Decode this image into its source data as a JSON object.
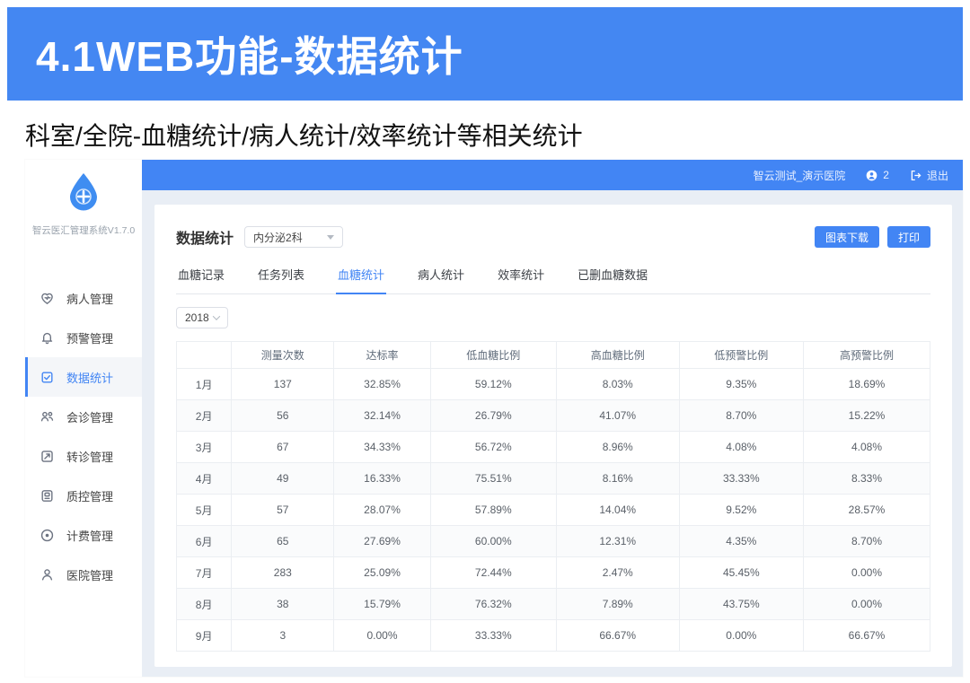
{
  "banner": {
    "title": "4.1WEB功能-数据统计"
  },
  "subtitle": "科室/全院-血糖统计/病人统计/效率统计等相关统计",
  "sidebar": {
    "system_name": "智云医汇管理系统V1.7.0",
    "logo_icon": "water-drop-medical-cross-logo",
    "items": [
      {
        "name": "patient-management",
        "label": "病人管理",
        "icon": "heart-pulse-icon",
        "active": false
      },
      {
        "name": "alert-management",
        "label": "预警管理",
        "icon": "bell-icon",
        "active": false
      },
      {
        "name": "data-statistics",
        "label": "数据统计",
        "icon": "clipboard-check-icon",
        "active": true
      },
      {
        "name": "consult-management",
        "label": "会诊管理",
        "icon": "people-icon",
        "active": false
      },
      {
        "name": "referral-management",
        "label": "转诊管理",
        "icon": "arrow-box-icon",
        "active": false
      },
      {
        "name": "quality-management",
        "label": "质控管理",
        "icon": "qc-badge-icon",
        "active": false
      },
      {
        "name": "billing-management",
        "label": "计费管理",
        "icon": "target-icon",
        "active": false
      },
      {
        "name": "hospital-management",
        "label": "医院管理",
        "icon": "person-icon",
        "active": false
      }
    ]
  },
  "topbar": {
    "hospital_name": "智云测试_演示医院",
    "user_icon": "user-circle-icon",
    "user_count": "2",
    "logout_icon": "logout-icon",
    "logout_label": "退出"
  },
  "content": {
    "page_title": "数据统计",
    "department_select_value": "内分泌2科",
    "buttons": {
      "download": "图表下载",
      "print": "打印"
    },
    "tabs": [
      {
        "name": "glucose-records",
        "label": "血糖记录",
        "active": false
      },
      {
        "name": "task-list",
        "label": "任务列表",
        "active": false
      },
      {
        "name": "glucose-statistics",
        "label": "血糖统计",
        "active": true
      },
      {
        "name": "patient-statistics",
        "label": "病人统计",
        "active": false
      },
      {
        "name": "efficiency-statistics",
        "label": "效率统计",
        "active": false
      },
      {
        "name": "deleted-glucose-data",
        "label": "已删血糖数据",
        "active": false
      }
    ],
    "year_select_value": "2018",
    "table": {
      "columns": [
        "",
        "测量次数",
        "达标率",
        "低血糖比例",
        "高血糖比例",
        "低预警比例",
        "高预警比例"
      ],
      "rows": [
        [
          "1月",
          "137",
          "32.85%",
          "59.12%",
          "8.03%",
          "9.35%",
          "18.69%"
        ],
        [
          "2月",
          "56",
          "32.14%",
          "26.79%",
          "41.07%",
          "8.70%",
          "15.22%"
        ],
        [
          "3月",
          "67",
          "34.33%",
          "56.72%",
          "8.96%",
          "4.08%",
          "4.08%"
        ],
        [
          "4月",
          "49",
          "16.33%",
          "75.51%",
          "8.16%",
          "33.33%",
          "8.33%"
        ],
        [
          "5月",
          "57",
          "28.07%",
          "57.89%",
          "14.04%",
          "9.52%",
          "28.57%"
        ],
        [
          "6月",
          "65",
          "27.69%",
          "60.00%",
          "12.31%",
          "4.35%",
          "8.70%"
        ],
        [
          "7月",
          "283",
          "25.09%",
          "72.44%",
          "2.47%",
          "45.45%",
          "0.00%"
        ],
        [
          "8月",
          "38",
          "15.79%",
          "76.32%",
          "7.89%",
          "43.75%",
          "0.00%"
        ],
        [
          "9月",
          "3",
          "0.00%",
          "33.33%",
          "66.67%",
          "0.00%",
          "66.67%"
        ]
      ]
    }
  },
  "colors": {
    "primary": "#4285f4",
    "banner": "#4487f2",
    "content-bg": "#e9eef5",
    "border": "#ebeef2",
    "text": "#5a6068"
  }
}
